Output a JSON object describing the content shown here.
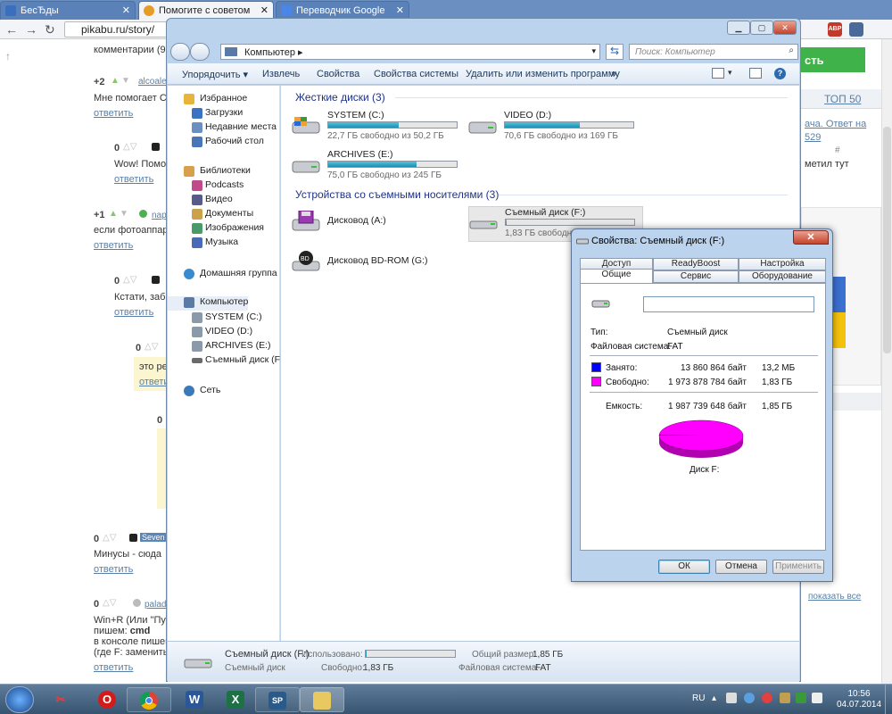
{
  "browser": {
    "tabs": [
      {
        "label": "БесЂды",
        "color": "#3a6fbf"
      },
      {
        "label": "Помогите с советом",
        "color": "#e79c2a"
      },
      {
        "label": "Переводчик Google",
        "color": "#4a86e8"
      }
    ],
    "url": "pikabu.ru/story/",
    "ext_abp": "ABP"
  },
  "page": {
    "comments_header": "комментарии (9)",
    "reply": "ответить",
    "c1_vote": "+2",
    "c1_user": "alcoale",
    "c1_text": "Мне помогает Са",
    "c2_vote": "0",
    "c2_text": "Wow! Помог",
    "c3_vote": "+1",
    "c3_user": "nap",
    "c3_text": "если фотоаппара",
    "c4_vote": "0",
    "c4_text": "Кстати, забы",
    "c5_vote": "0",
    "c5_text": "это ре",
    "c6_vote": "0",
    "c7_vote": "0",
    "c7_user": "Seven",
    "c7_text": "Минусы - сюда",
    "c8_vote": "0",
    "c8_user": "palad",
    "c8_line1": "Win+R (Или \"Пуск",
    "c8_line2a": "пишем: ",
    "c8_line2b": "cmd",
    "c8_line3": "в консоле пишем",
    "c8_line4": "(где F: заменить",
    "green_btn": "сть",
    "top50": "ТОП 50",
    "right_link1": "ача. Ответ на",
    "right_link2": "529",
    "right_hash": "#",
    "right_text": "метил тут",
    "show_all": "показать все"
  },
  "explorer": {
    "path": "Компьютер",
    "search_placeholder": "Поиск: Компьютер",
    "commands": [
      "Упорядочить ▾",
      "Извлечь",
      "Свойства",
      "Свойства системы",
      "Удалить или изменить программу",
      "»"
    ],
    "nav": [
      {
        "label": "Избранное",
        "lvl": 0,
        "color": "#e8b53a"
      },
      {
        "label": "Загрузки",
        "lvl": 1,
        "color": "#3b72c4"
      },
      {
        "label": "Недавние места",
        "lvl": 1,
        "color": "#6a8fc0"
      },
      {
        "label": "Рабочий стол",
        "lvl": 1,
        "color": "#4a76b8"
      },
      {
        "label": "Библиотеки",
        "lvl": 0,
        "color": "#d8a04a"
      },
      {
        "label": "Podcasts",
        "lvl": 1,
        "color": "#c04a8a"
      },
      {
        "label": "Видео",
        "lvl": 1,
        "color": "#5a5a8a"
      },
      {
        "label": "Документы",
        "lvl": 1,
        "color": "#c9a24a"
      },
      {
        "label": "Изображения",
        "lvl": 1,
        "color": "#4a9a6a"
      },
      {
        "label": "Музыка",
        "lvl": 1,
        "color": "#4a6ab8"
      },
      {
        "label": "Домашняя группа",
        "lvl": 0,
        "color": "#3a8ad0"
      },
      {
        "label": "Компьютер",
        "lvl": 0,
        "color": "#5a7aa8"
      },
      {
        "label": "SYSTEM (C:)",
        "lvl": 1,
        "color": "#8a9aaa"
      },
      {
        "label": "VIDEO (D:)",
        "lvl": 1,
        "color": "#8a9aaa"
      },
      {
        "label": "ARCHIVES (E:)",
        "lvl": 1,
        "color": "#8a9aaa"
      },
      {
        "label": "Съемный диск (F:)",
        "lvl": 1,
        "color": "#6a6a6a"
      },
      {
        "label": "Сеть",
        "lvl": 0,
        "color": "#3a7ab8"
      }
    ],
    "group_hdd": "Жесткие диски (3)",
    "group_removable": "Устройства со съемными носителями (3)",
    "drives": [
      {
        "name": "SYSTEM (C:)",
        "free": "22,7 ГБ свободно из 50,2 ГБ",
        "used": 0.55
      },
      {
        "name": "VIDEO (D:)",
        "free": "70,6 ГБ свободно из 169 ГБ",
        "used": 0.58
      },
      {
        "name": "ARCHIVES (E:)",
        "free": "75,0 ГБ свободно из 245 ГБ",
        "used": 0.69
      }
    ],
    "removable": [
      {
        "name": "Дисковод (A:)"
      },
      {
        "name": "Съемный диск (F:)",
        "free": "1,83 ГБ свободно",
        "used": 0.01
      },
      {
        "name": "Дисковод BD-ROM (G:)"
      }
    ],
    "status": {
      "name": "Съемный диск (F:)",
      "type": "Съемный диск",
      "used_label": "Использовано:",
      "free_label": "Свободно:",
      "free_value": "1,83 ГБ",
      "total_label": "Общий размер:",
      "total_value": "1,85 ГБ",
      "fs_label": "Файловая система:",
      "fs_value": "FAT",
      "used_fraction": 0.01
    }
  },
  "dialog": {
    "title": "Свойства: Съемный диск (F:)",
    "close": "✕",
    "tabs_row1": [
      "Доступ",
      "ReadyBoost",
      "Настройка"
    ],
    "tabs_row2": [
      "Общие",
      "Сервис",
      "Оборудование"
    ],
    "type_label": "Тип:",
    "type_value": "Съемный диск",
    "fs_label": "Файловая система:",
    "fs_value": "FAT",
    "used_label": "Занято:",
    "used_bytes": "13 860 864 байт",
    "used_size": "13,2 МБ",
    "free_label": "Свободно:",
    "free_bytes": "1 973 878 784 байт",
    "free_size": "1,83 ГБ",
    "capacity_label": "Емкость:",
    "capacity_bytes": "1 987 739 648 байт",
    "capacity_size": "1,85 ГБ",
    "disk_label": "Диск F:",
    "used_color": "#0000ff",
    "free_color": "#ff00ff",
    "used_fraction": 0.007,
    "ok": "ОК",
    "cancel": "Отмена",
    "apply": "Применить"
  },
  "taskbar": {
    "items": [
      "start-orb",
      "scissors",
      "opera",
      "chrome",
      "word",
      "excel",
      "sp",
      "folder"
    ],
    "lang": "RU",
    "time": "10:56",
    "date": "04.07.2014"
  }
}
